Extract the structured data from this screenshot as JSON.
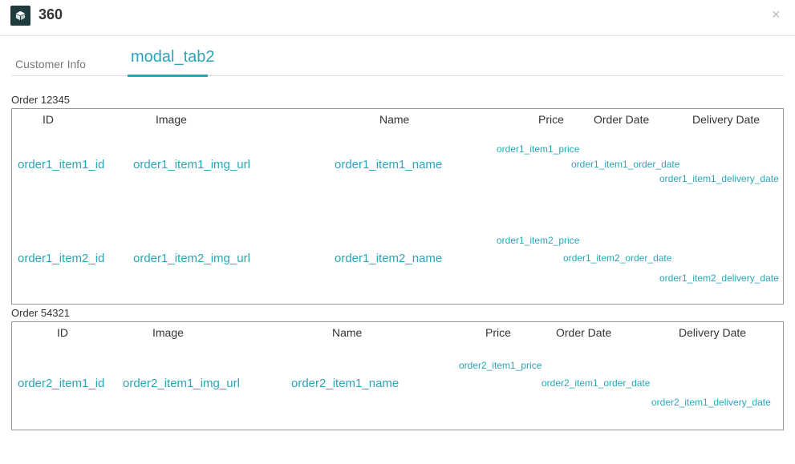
{
  "header": {
    "title": "360",
    "logo_icon": "cube-icon",
    "close_icon": "close-icon",
    "close_glyph": "×"
  },
  "tabs": [
    {
      "label": "Customer Info",
      "active": false
    },
    {
      "label": "modal_tab2",
      "active": true
    }
  ],
  "columns": [
    "ID",
    "Image",
    "Name",
    "Price",
    "Order Date",
    "Delivery Date"
  ],
  "orders": [
    {
      "label": "Order 12345",
      "items": [
        {
          "id": "order1_item1_id",
          "img_url": "order1_item1_img_url",
          "name": "order1_item1_name",
          "price": "order1_item1_price",
          "order_date": "order1_item1_order_date",
          "delivery_date": "order1_item1_delivery_date"
        },
        {
          "id": "order1_item2_id",
          "img_url": "order1_item2_img_url",
          "name": "order1_item2_name",
          "price": "order1_item2_price",
          "order_date": "order1_item2_order_date",
          "delivery_date": "order1_item2_delivery_date"
        }
      ]
    },
    {
      "label": "Order 54321",
      "items": [
        {
          "id": "order2_item1_id",
          "img_url": "order2_item1_img_url",
          "name": "order2_item1_name",
          "price": "order2_item1_price",
          "order_date": "order2_item1_order_date",
          "delivery_date": "order2_item1_delivery_date"
        }
      ]
    }
  ],
  "colors": {
    "accent": "#2aa6b8",
    "logo_bg": "#1f3b3d",
    "border": "#999999"
  }
}
